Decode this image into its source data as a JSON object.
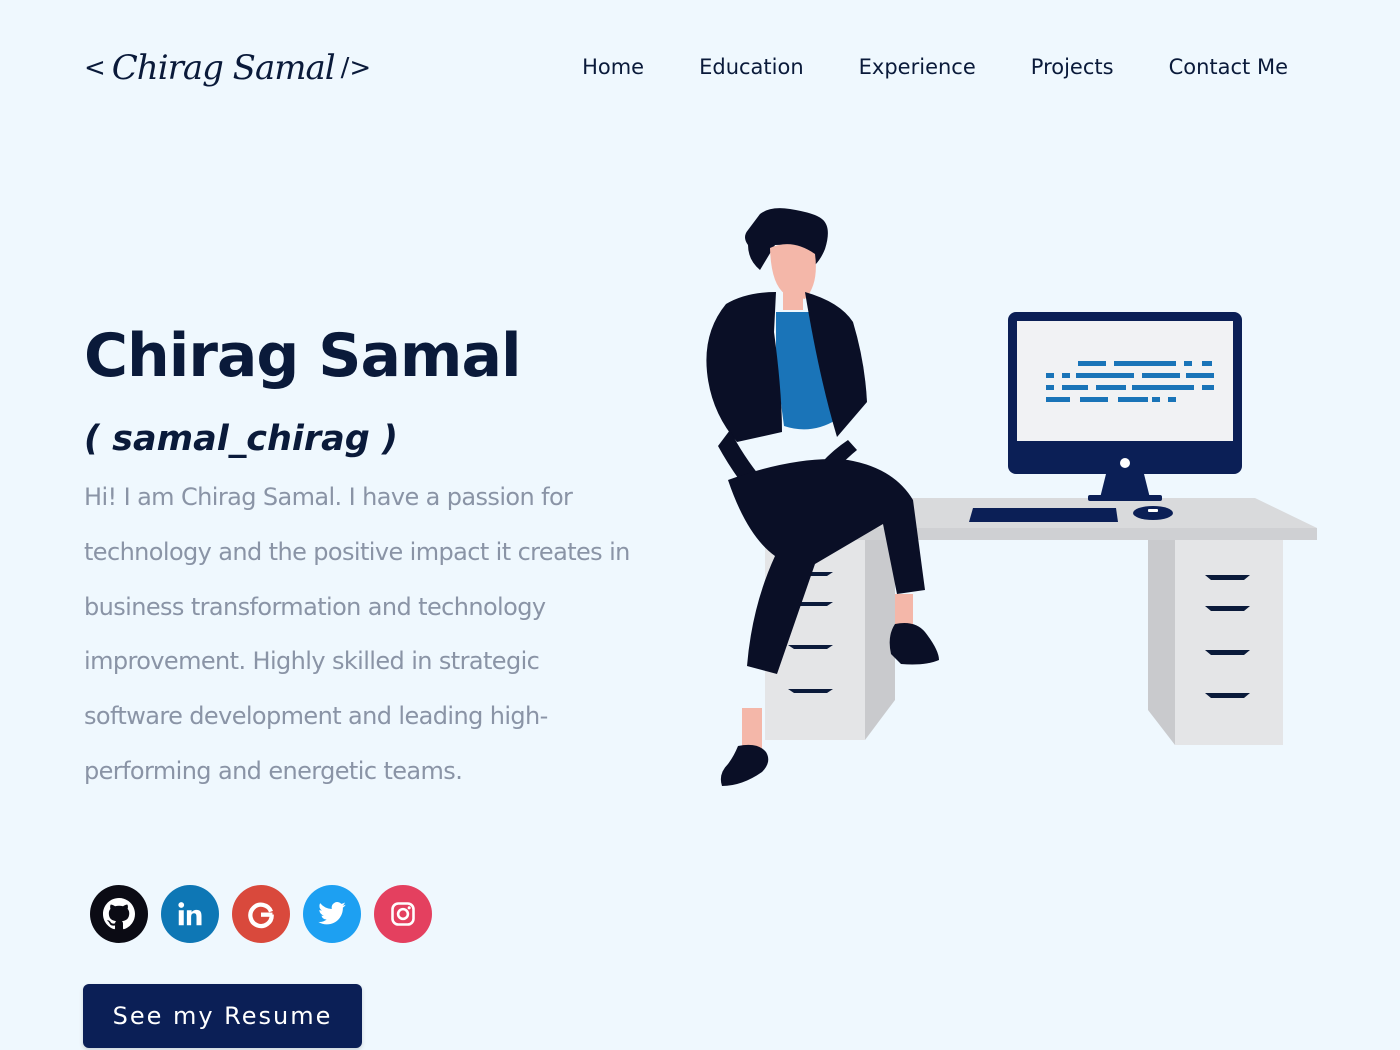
{
  "header": {
    "logo": {
      "open_bracket": "<",
      "signature": "Chirag Samal",
      "close_bracket": "/>"
    },
    "nav": [
      {
        "label": "Home"
      },
      {
        "label": "Education"
      },
      {
        "label": "Experience"
      },
      {
        "label": "Projects"
      },
      {
        "label": "Contact Me"
      }
    ]
  },
  "hero": {
    "title": "Chirag Samal",
    "handle": "( samal_chirag )",
    "description": "Hi! I am Chirag Samal. I have a passion for technology and the positive impact it creates in business transformation and technology improvement. Highly skilled in strategic software development and leading high-performing and energetic teams.",
    "socials": [
      {
        "icon": "github-icon",
        "color": "#0b0b14"
      },
      {
        "icon": "linkedin-icon",
        "color": "#0e77b5"
      },
      {
        "icon": "google-icon",
        "color": "#d9493c"
      },
      {
        "icon": "twitter-icon",
        "color": "#1da0f2"
      },
      {
        "icon": "instagram-icon",
        "color": "#e4405f"
      }
    ],
    "resume_button": "See my Resume"
  },
  "colors": {
    "background": "#eff8fe",
    "primary": "#0a1a3a",
    "text_muted": "#8a94a6",
    "button": "#0b1f56"
  }
}
